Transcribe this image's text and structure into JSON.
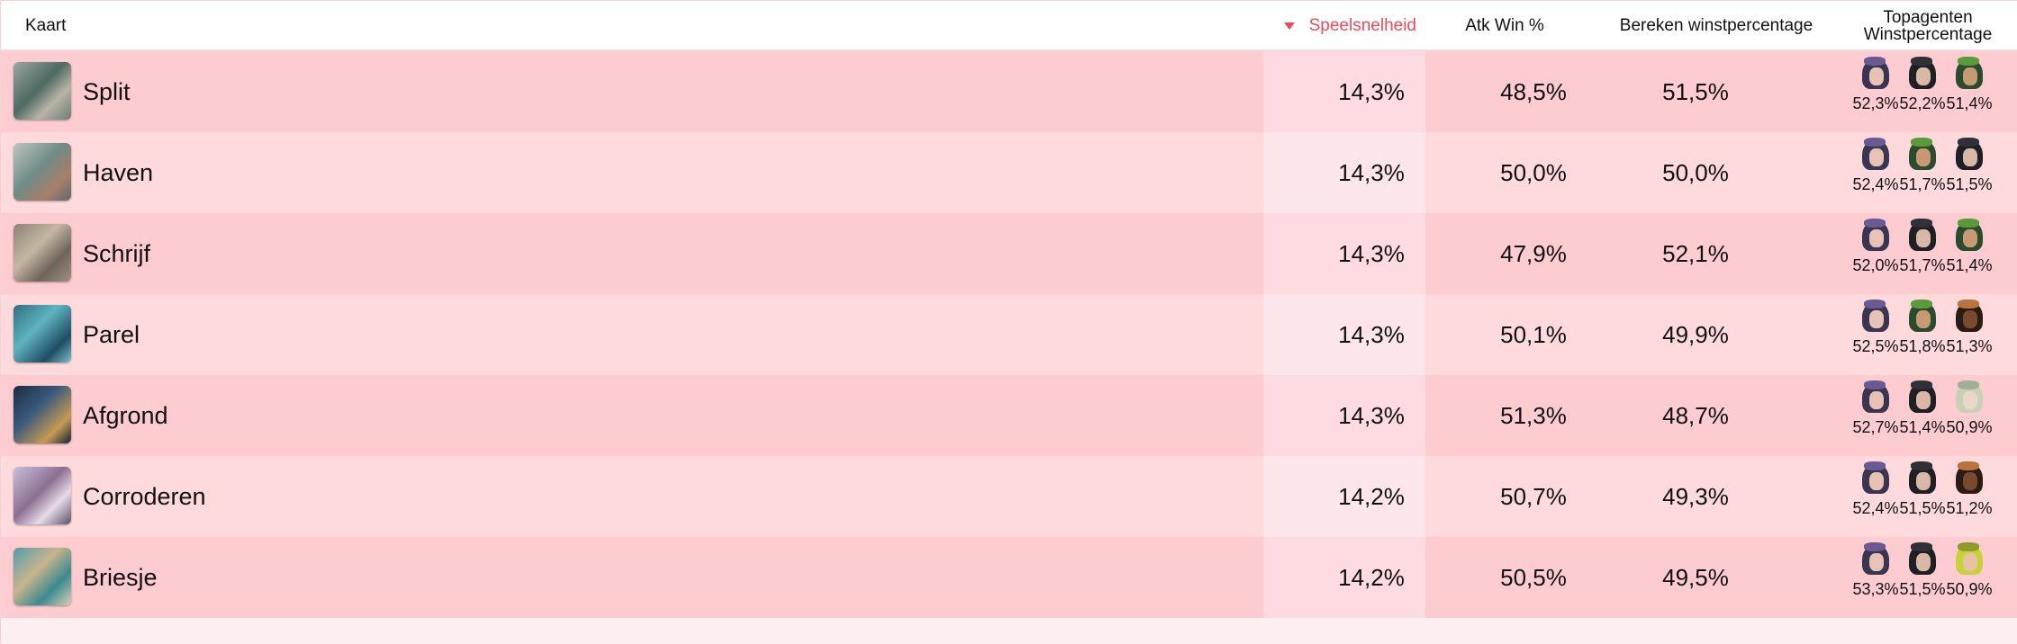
{
  "header": {
    "map": "Kaart",
    "play_rate": "Speelsnelheid",
    "atk_win": "Atk Win %",
    "def_win": "Bereken winstpercentage",
    "top_agents_line1": "Topagenten",
    "top_agents_line2": "Winstpercentage",
    "sort_color": "#ec4a59"
  },
  "rows": [
    {
      "map": "Split",
      "thumb": "split-map-thumbnail",
      "play": "14,3%",
      "atk": "48,5%",
      "def": "51,5%",
      "agents": [
        {
          "icon": "agent-purple-hair-icon",
          "pct": "52,3%"
        },
        {
          "icon": "agent-dark-hair-icon",
          "pct": "52,2%"
        },
        {
          "icon": "agent-green-hat-icon",
          "pct": "51,4%"
        }
      ]
    },
    {
      "map": "Haven",
      "thumb": "haven-map-thumbnail",
      "play": "14,3%",
      "atk": "50,0%",
      "def": "50,0%",
      "agents": [
        {
          "icon": "agent-purple-hair-icon",
          "pct": "52,4%"
        },
        {
          "icon": "agent-green-hat-icon",
          "pct": "51,7%"
        },
        {
          "icon": "agent-dark-hair-icon",
          "pct": "51,5%"
        }
      ]
    },
    {
      "map": "Schrijf",
      "thumb": "schrijf-map-thumbnail",
      "play": "14,3%",
      "atk": "47,9%",
      "def": "52,1%",
      "agents": [
        {
          "icon": "agent-purple-hair-icon",
          "pct": "52,0%"
        },
        {
          "icon": "agent-dark-hair-icon",
          "pct": "51,7%"
        },
        {
          "icon": "agent-green-hat-icon",
          "pct": "51,4%"
        }
      ]
    },
    {
      "map": "Parel",
      "thumb": "parel-map-thumbnail",
      "play": "14,3%",
      "atk": "50,1%",
      "def": "49,9%",
      "agents": [
        {
          "icon": "agent-purple-hair-icon",
          "pct": "52,5%"
        },
        {
          "icon": "agent-green-hat-icon",
          "pct": "51,8%"
        },
        {
          "icon": "agent-brown-skin-icon",
          "pct": "51,3%"
        }
      ]
    },
    {
      "map": "Afgrond",
      "thumb": "afgrond-map-thumbnail",
      "play": "14,3%",
      "atk": "51,3%",
      "def": "48,7%",
      "agents": [
        {
          "icon": "agent-purple-hair-icon",
          "pct": "52,7%"
        },
        {
          "icon": "agent-dark-hair-icon",
          "pct": "51,4%"
        },
        {
          "icon": "agent-pale-hair-icon",
          "pct": "50,9%"
        }
      ]
    },
    {
      "map": "Corroderen",
      "thumb": "corroderen-map-thumbnail",
      "play": "14,2%",
      "atk": "50,7%",
      "def": "49,3%",
      "agents": [
        {
          "icon": "agent-purple-hair-icon",
          "pct": "52,4%"
        },
        {
          "icon": "agent-dark-hair-icon",
          "pct": "51,5%"
        },
        {
          "icon": "agent-brown-skin-icon",
          "pct": "51,2%"
        }
      ]
    },
    {
      "map": "Briesje",
      "thumb": "briesje-map-thumbnail",
      "play": "14,2%",
      "atk": "50,5%",
      "def": "49,5%",
      "agents": [
        {
          "icon": "agent-purple-hair-icon",
          "pct": "53,3%"
        },
        {
          "icon": "agent-dark-hair-icon",
          "pct": "51,5%"
        },
        {
          "icon": "agent-yellow-hair-icon",
          "pct": "50,9%"
        }
      ]
    }
  ]
}
